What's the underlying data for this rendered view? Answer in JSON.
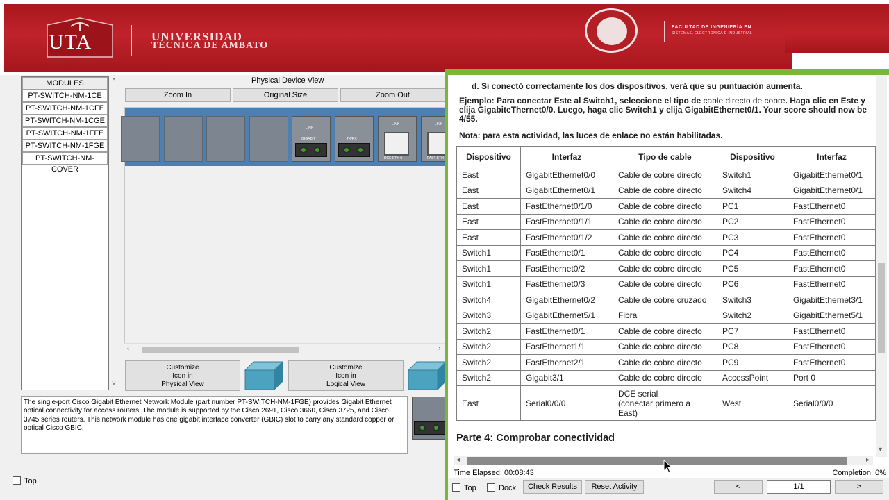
{
  "header": {
    "uta_logo_text": "UTA",
    "university_line1": "UNIVERSIDAD",
    "university_line2": "TÉCNICA DE AMBATO",
    "faculty_line1": "FACULTAD DE INGENIERÍA EN",
    "faculty_line2": "SISTEMAS, ELECTRÓNICA E INDUSTRIAL",
    "brand_color": "#b71c22"
  },
  "left_pane": {
    "modules_header": "MODULES",
    "modules": [
      "PT-SWITCH-NM-1CE",
      "PT-SWITCH-NM-1CFE",
      "PT-SWITCH-NM-1CGE",
      "PT-SWITCH-NM-1FFE",
      "PT-SWITCH-NM-1FGE",
      "PT-SWITCH-NM-COVER"
    ],
    "physical_device_view_title": "Physical Device View",
    "zoom_in": "Zoom In",
    "original_size": "Original Size",
    "zoom_out": "Zoom Out",
    "customize_physical": "Customize\nIcon in\nPhysical View",
    "customize_logical": "Customize\nIcon in\nLogical View",
    "description": "The single-port Cisco Gigabit Ethernet Network Module (part number PT-SWITCH-NM-1FGE) provides Gigabit Ethernet optical connectivity for access routers. The module is supported by the Cisco 2691, Cisco 3660, Cisco 3725, and Cisco 3745 series routers. This network module has one gigabit interface converter (GBIC) slot to carry any standard copper or optical Cisco GBIC.",
    "top_label": "Top",
    "port_labels": [
      "LINK",
      "GIGABIT",
      "TX/RX",
      "LINK",
      "DCE ETH 0",
      "LINK",
      "FAST ETH"
    ]
  },
  "right_pane": {
    "accent_color": "#76b83e",
    "step_d": "d.   Si conectó correctamente los dos dispositivos, verá que su puntuación aumenta.",
    "example_lead": "Ejemplo: Para conectar Este al Switch1, seleccione el tipo de ",
    "example_cable": "cable directo de cobre",
    "example_rest": ". Haga clic en Este y elija GigabiteThernet0/0. Luego, haga clic Switch1 y elija GigabitEthernet0/1. Your score should now be 4/55.",
    "note": "Nota: para esta actividad, las luces de enlace no están habilitadas.",
    "table_headers": [
      "Dispositivo",
      "Interfaz",
      "Tipo de cable",
      "Dispositivo",
      "Interfaz"
    ],
    "table_rows": [
      [
        "East",
        "GigabitEthernet0/0",
        "Cable de cobre directo",
        "Switch1",
        "GigabitEthernet0/1"
      ],
      [
        "East",
        "GigabitEthernet0/1",
        "Cable de cobre directo",
        "Switch4",
        "GigabitEthernet0/1"
      ],
      [
        "East",
        "FastEthernet0/1/0",
        "Cable de cobre directo",
        "PC1",
        "FastEthernet0"
      ],
      [
        "East",
        "FastEthernet0/1/1",
        "Cable de cobre directo",
        "PC2",
        "FastEthernet0"
      ],
      [
        "East",
        "FastEthernet0/1/2",
        "Cable de cobre directo",
        "PC3",
        "FastEthernet0"
      ],
      [
        "Switch1",
        "FastEthernet0/1",
        "Cable de cobre directo",
        "PC4",
        "FastEthernet0"
      ],
      [
        "Switch1",
        "FastEthernet0/2",
        "Cable de cobre directo",
        "PC5",
        "FastEthernet0"
      ],
      [
        "Switch1",
        "FastEthernet0/3",
        "Cable de cobre directo",
        "PC6",
        "FastEthernet0"
      ],
      [
        "Switch4",
        "GigabitEthernet0/2",
        "Cable de cobre cruzado",
        "Switch3",
        "GigabitEthernet3/1"
      ],
      [
        "Switch3",
        "GigabitEthernet5/1",
        "Fibra",
        "Switch2",
        "GigabitEthernet5/1"
      ],
      [
        "Switch2",
        "FastEthernet0/1",
        "Cable de cobre directo",
        "PC7",
        "FastEthernet0"
      ],
      [
        "Switch2",
        "FastEthernet1/1",
        "Cable de cobre directo",
        "PC8",
        "FastEthernet0"
      ],
      [
        "Switch2",
        "FastEthernet2/1",
        "Cable de cobre directo",
        "PC9",
        "FastEthernet0"
      ],
      [
        "Switch2",
        "Gigabit3/1",
        "Cable de cobre directo",
        "AccessPoint",
        "Port 0"
      ],
      [
        "East",
        "Serial0/0/0",
        "DCE serial\n(conectar primero a\nEast)",
        "West",
        "Serial0/0/0"
      ]
    ],
    "part4_title": "Parte 4: Comprobar conectividad",
    "time_elapsed": "Time Elapsed: 00:08:43",
    "completion": "Completion: 0%",
    "top_label": "Top",
    "dock_label": "Dock",
    "check_results": "Check Results",
    "reset_activity": "Reset Activity",
    "prev": "<",
    "page": "1/1",
    "next": ">"
  }
}
